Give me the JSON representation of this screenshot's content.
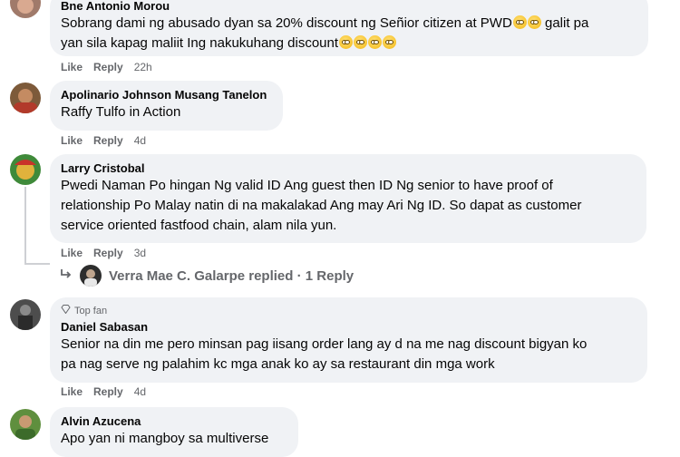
{
  "actions": {
    "like": "Like",
    "reply": "Reply"
  },
  "comments": [
    {
      "author": "Bne Antonio Morou",
      "text": "Sobrang dami ng abusado dyan sa 20% discount ng Señior citizen at PWD",
      "text2_start": "galit pa",
      "text2": "yan sila kapag maliit Ing nakukuhang discount",
      "time": "22h"
    },
    {
      "author": "Apolinario Johnson Musang Tanelon",
      "text": "Raffy Tulfo in Action",
      "time": "4d"
    },
    {
      "author": "Larry Cristobal",
      "lines": [
        "Pwedi Naman Po hingan Ng valid ID Ang guest then ID Ng senior to have proof of",
        "relationship Po Malay natin di na makalakad Ang may Ari Ng ID. So dapat as customer",
        "service oriented fastfood chain, alam nila yun."
      ],
      "time": "3d",
      "replies_text": "Verra Mae C. Galarpe replied · 1 Reply"
    },
    {
      "badge": "Top fan",
      "author": "Daniel Sabasan",
      "lines": [
        "Senior na din me pero minsan pag iisang order lang ay d na me nag discount bigyan ko",
        "pa nag serve ng palahim kc mga anak ko ay sa restaurant din mga work"
      ],
      "time": "4d"
    },
    {
      "author": "Alvin Azucena",
      "text": "Apo yan ni mangboy sa multiverse"
    }
  ],
  "icons": {
    "emoji": "face-with-rolling-eyes-icon",
    "reply_arrow": "reply-arrow-icon",
    "top_fan": "diamond-icon"
  }
}
